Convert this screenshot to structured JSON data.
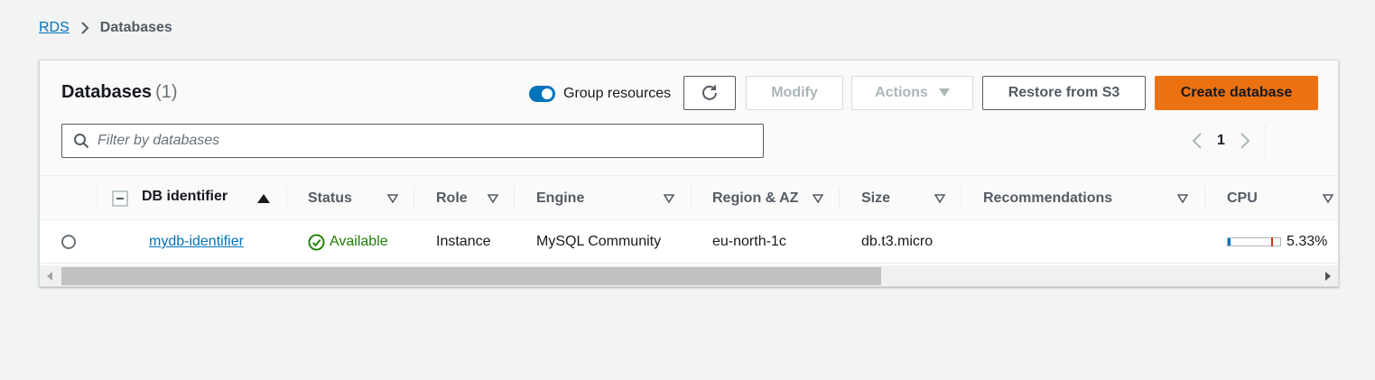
{
  "breadcrumb": {
    "root": "RDS",
    "current": "Databases"
  },
  "panel": {
    "title": "Databases",
    "count": "(1)",
    "group_resources_label": "Group resources",
    "group_resources_on": true,
    "buttons": {
      "modify": "Modify",
      "actions": "Actions",
      "restore": "Restore from S3",
      "create": "Create database"
    },
    "filter_placeholder": "Filter by databases",
    "page": "1"
  },
  "table": {
    "columns": [
      "DB identifier",
      "Status",
      "Role",
      "Engine",
      "Region & AZ",
      "Size",
      "Recommendations",
      "CPU"
    ],
    "rows": [
      {
        "db_identifier": "mydb-identifier",
        "status": "Available",
        "role": "Instance",
        "engine": "MySQL Community",
        "region_az": "eu-north-1c",
        "size": "db.t3.micro",
        "recommendations": "",
        "cpu": "5.33%",
        "cpu_fraction": 0.0533
      }
    ]
  },
  "colors": {
    "link": "#0073bb",
    "primary": "#ec7211",
    "success": "#1d8102",
    "toggle": "#0073bb"
  }
}
